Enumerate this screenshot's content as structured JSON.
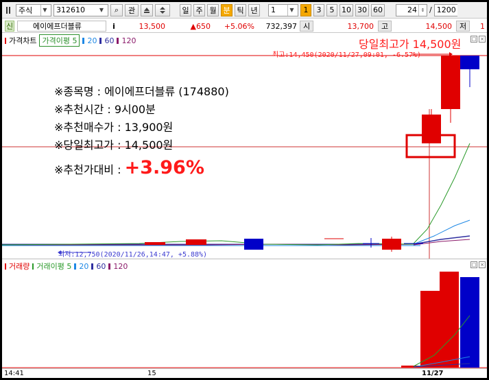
{
  "toolbar": {
    "market": "주식",
    "code": "312610",
    "btn_search": "⌕",
    "btn_kwan": "관",
    "periods": [
      "일",
      "주",
      "월",
      "분",
      "틱",
      "년"
    ],
    "active_period": "분",
    "interval_value": "1",
    "interval_buttons": [
      "1",
      "3",
      "5",
      "10",
      "30",
      "60"
    ],
    "active_interval": "1",
    "count_value": "24",
    "slash": "/",
    "total_value": "1200"
  },
  "quote": {
    "badge": "신",
    "name": "에이에프더블류",
    "info_btn": "i",
    "price": "13,500",
    "change": "▲650",
    "change_pct": "+5.06%",
    "volume": "732,397",
    "open_label": "시",
    "open": "13,700",
    "high_label": "고",
    "high": "14,500",
    "low_label": "저",
    "low": "1"
  },
  "price_panel": {
    "legend_title": "가격차트",
    "ma_box": "가격이평 5",
    "ma_items": [
      "20",
      "60",
      "120"
    ],
    "day_high_text": "당일최고가 14,500원",
    "high_marker": "최고:14,450(2020/11/27,09:01, -6.57%)",
    "low_marker": "최저:12,750(2020/11/26,14:47, +5.88%)"
  },
  "annotation": {
    "line1": "※종목명 : 에이에프더블류 (174880)",
    "line2": "※추천시간 : 9시00분",
    "line3": "※추천매수가 : 13,900원",
    "line4": "※당일최고가 : 14,500원",
    "line5_label": "※추천가대비 : ",
    "line5_value": "+3.96%"
  },
  "vol_panel": {
    "legend_title": "거래량",
    "ma_label": "거래이평 5",
    "ma_items": [
      "20",
      "60",
      "120"
    ]
  },
  "xaxis": {
    "ticks": [
      "14:41",
      "15",
      "11/27"
    ]
  },
  "colors": {
    "up": "#e00000",
    "down": "#0000c8",
    "ma5": "#2a9a2a",
    "ma20": "#1e88e5",
    "ma60": "#2f2fa0",
    "ma120": "#8b1a6a"
  }
}
